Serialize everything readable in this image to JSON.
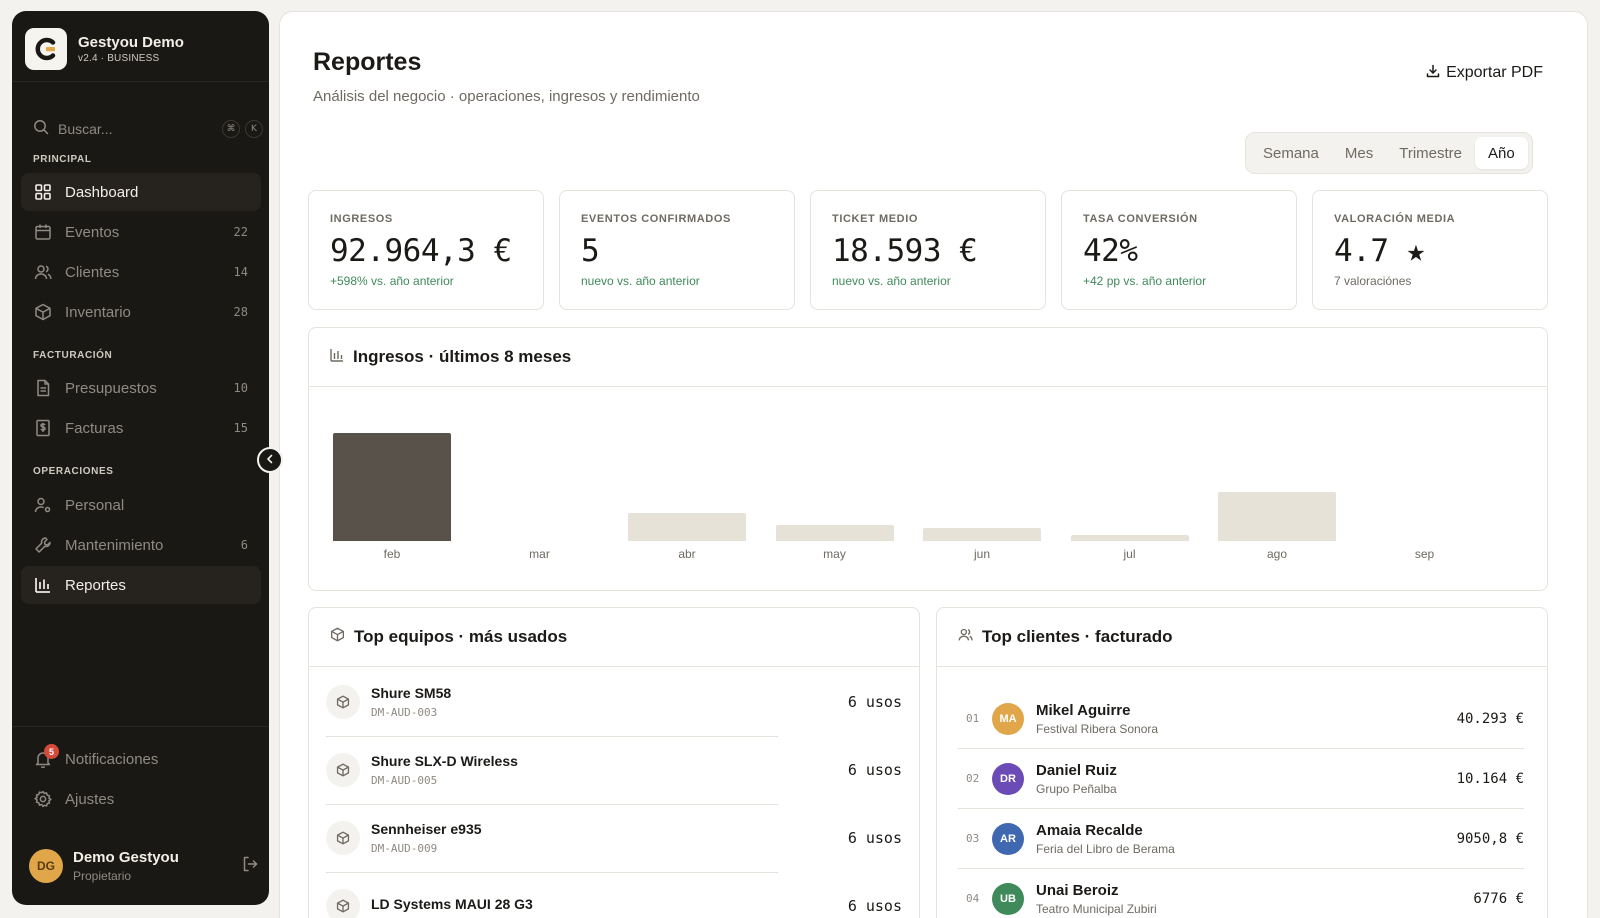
{
  "brand": {
    "name": "Gestyou Demo",
    "version": "v2.4 · BUSINESS"
  },
  "search": {
    "placeholder": "Buscar...",
    "kbd1": "⌘",
    "kbd2": "K"
  },
  "sections": {
    "principal": "PRINCIPAL",
    "facturacion": "FACTURACIÓN",
    "operaciones": "OPERACIONES"
  },
  "nav": {
    "dashboard": {
      "label": "Dashboard"
    },
    "eventos": {
      "label": "Eventos",
      "count": "22"
    },
    "clientes": {
      "label": "Clientes",
      "count": "14"
    },
    "inventario": {
      "label": "Inventario",
      "count": "28"
    },
    "presupuestos": {
      "label": "Presupuestos",
      "count": "10"
    },
    "facturas": {
      "label": "Facturas",
      "count": "15"
    },
    "personal": {
      "label": "Personal"
    },
    "mantenimiento": {
      "label": "Mantenimiento",
      "count": "6"
    },
    "reportes": {
      "label": "Reportes"
    },
    "notificaciones": {
      "label": "Notificaciones",
      "badge": "5"
    },
    "ajustes": {
      "label": "Ajustes"
    }
  },
  "user": {
    "initials": "DG",
    "name": "Demo Gestyou",
    "role": "Propietario"
  },
  "page": {
    "title": "Reportes",
    "subtitle": "Análisis del negocio · operaciones, ingresos y rendimiento",
    "export_label": "Exportar PDF"
  },
  "periods": [
    "Semana",
    "Mes",
    "Trimestre",
    "Año"
  ],
  "active_period": "Año",
  "kpis": [
    {
      "label": "INGRESOS",
      "value": "92.964,3 €",
      "delta": "+598% vs. año anterior",
      "tone": "positive"
    },
    {
      "label": "EVENTOS CONFIRMADOS",
      "value": "5",
      "delta": "nuevo vs. año anterior",
      "tone": "positive"
    },
    {
      "label": "TICKET MEDIO",
      "value": "18.593 €",
      "delta": "nuevo vs. año anterior",
      "tone": "positive"
    },
    {
      "label": "TASA CONVERSIÓN",
      "value": "42%",
      "delta": "+42 pp vs. año anterior",
      "tone": "positive"
    },
    {
      "label": "VALORACIÓN MEDIA",
      "value": "4.7 ★",
      "delta": "7 valoraciónes",
      "tone": "neutral"
    }
  ],
  "revenue_card": {
    "title": "Ingresos · últimos 8 meses"
  },
  "chart_data": {
    "type": "bar",
    "categories": [
      "feb",
      "mar",
      "abr",
      "may",
      "jun",
      "jul",
      "ago",
      "sep"
    ],
    "values": [
      58000,
      0,
      15000,
      8500,
      7000,
      3000,
      26500,
      0
    ],
    "ylim": [
      0,
      70000
    ],
    "highlight_index": 0,
    "colors": {
      "highlight": "#58524a",
      "default": "#e6e2d8"
    }
  },
  "equipment_card": {
    "title": "Top equipos · más usados",
    "items": [
      {
        "name": "Shure SM58",
        "code": "DM-AUD-003",
        "uses": "6 usos"
      },
      {
        "name": "Shure SLX-D Wireless",
        "code": "DM-AUD-005",
        "uses": "6 usos"
      },
      {
        "name": "Sennheiser e935",
        "code": "DM-AUD-009",
        "uses": "6 usos"
      },
      {
        "name": "LD Systems MAUI 28 G3",
        "code": "",
        "uses": "6 usos"
      }
    ]
  },
  "clients_card": {
    "title": "Top clientes · facturado",
    "items": [
      {
        "rank": "01",
        "initials": "MA",
        "name": "Mikel Aguirre",
        "company": "Festival Ribera Sonora",
        "amount": "40.293 €",
        "color": "#e0a649"
      },
      {
        "rank": "02",
        "initials": "DR",
        "name": "Daniel Ruiz",
        "company": "Grupo Peñalba",
        "amount": "10.164 €",
        "color": "#6b4bb5"
      },
      {
        "rank": "03",
        "initials": "AR",
        "name": "Amaia Recalde",
        "company": "Feria del Libro de Berama",
        "amount": "9050,8 €",
        "color": "#3f68b0"
      },
      {
        "rank": "04",
        "initials": "UB",
        "name": "Unai Beroiz",
        "company": "Teatro Municipal Zubiri",
        "amount": "6776 €",
        "color": "#3f8a5a"
      }
    ]
  },
  "colors": {
    "sidebar_bg": "#1a1815",
    "positive": "#3f8a5a",
    "notif": "#d64a3b"
  }
}
